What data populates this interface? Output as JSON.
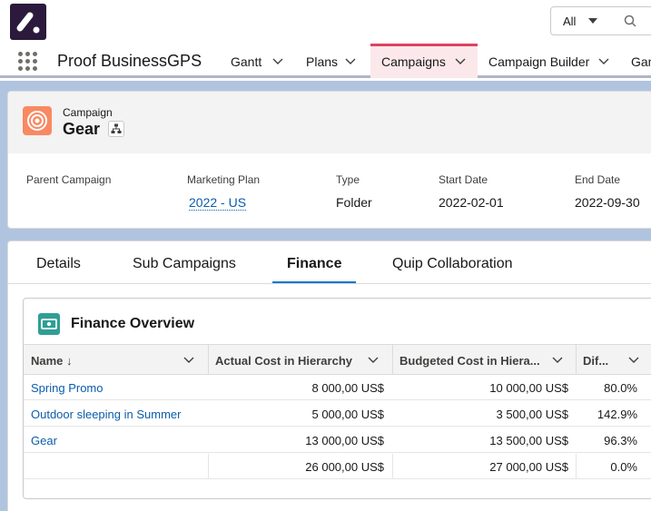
{
  "header": {
    "search_scope": "All",
    "app_name": "Proof BusinessGPS"
  },
  "nav": {
    "tabs": [
      {
        "label": "Gantt"
      },
      {
        "label": "Plans"
      },
      {
        "label": "Campaigns"
      },
      {
        "label": "Campaign Builder"
      },
      {
        "label": "Gan"
      }
    ],
    "active_tab": "Campaigns",
    "active_color": "#e0425e"
  },
  "record": {
    "entity": "Campaign",
    "name": "Gear",
    "icon": "campaign-target-icon",
    "fields": [
      {
        "label": "Parent Campaign",
        "value": ""
      },
      {
        "label": "Marketing Plan",
        "value": "2022 - US"
      },
      {
        "label": "Type",
        "value": "Folder"
      },
      {
        "label": "Start Date",
        "value": "2022-02-01"
      },
      {
        "label": "End Date",
        "value": "2022-09-30"
      }
    ]
  },
  "tabs": [
    {
      "label": "Details"
    },
    {
      "label": "Sub Campaigns"
    },
    {
      "label": "Finance"
    },
    {
      "label": "Quip Collaboration"
    }
  ],
  "active_tab": "Finance",
  "finance": {
    "title": "Finance Overview",
    "icon": "money-icon",
    "columns": [
      {
        "label": "Name ↓"
      },
      {
        "label": "Actual Cost in Hierarchy"
      },
      {
        "label": "Budgeted Cost in Hiera..."
      },
      {
        "label": "Dif..."
      }
    ],
    "rows": [
      {
        "name": "Spring Promo",
        "actual": "8 000,00 US$",
        "budget": "10 000,00 US$",
        "diff": "80.0%"
      },
      {
        "name": "Outdoor sleeping in Summer",
        "actual": "5 000,00 US$",
        "budget": "3 500,00 US$",
        "diff": "142.9%"
      },
      {
        "name": "Gear",
        "actual": "13 000,00 US$",
        "budget": "13 500,00 US$",
        "diff": "96.3%"
      },
      {
        "name": "",
        "actual": "26 000,00 US$",
        "budget": "27 000,00 US$",
        "diff": "0.0%"
      }
    ]
  }
}
